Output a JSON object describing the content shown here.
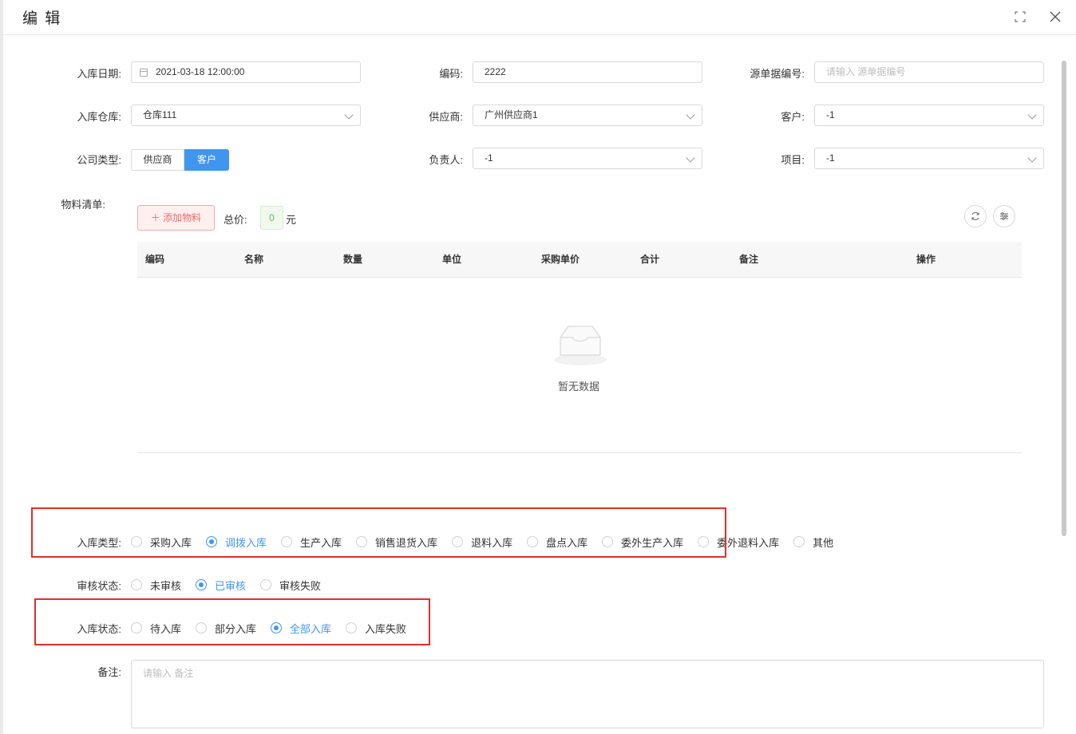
{
  "header": {
    "title": "编 辑"
  },
  "form": {
    "inbound_date": {
      "label": "入库日期:",
      "value": "2021-03-18 12:00:00"
    },
    "code": {
      "label": "编码:",
      "value": "2222"
    },
    "source_no": {
      "label": "源单据编号:",
      "placeholder": "请输入 源单据编号"
    },
    "warehouse": {
      "label": "入库仓库:",
      "value": "仓库111"
    },
    "supplier": {
      "label": "供应商:",
      "value": "广州供应商1"
    },
    "customer": {
      "label": "客户:",
      "value": "-1"
    },
    "company_type": {
      "label": "公司类型:",
      "options": [
        "供应商",
        "客户"
      ],
      "selected": "客户"
    },
    "person": {
      "label": "负责人:",
      "value": "-1"
    },
    "project": {
      "label": "项目:",
      "value": "-1"
    }
  },
  "materials": {
    "label": "物料清单:",
    "add_button": "添加物料",
    "total_label": "总价:",
    "total_value": "0",
    "currency": "元",
    "columns": [
      "编码",
      "名称",
      "数量",
      "单位",
      "采购单价",
      "合计",
      "备注",
      "操作"
    ],
    "empty_text": "暂无数据"
  },
  "inbound_type": {
    "label": "入库类型:",
    "options": [
      "采购入库",
      "调拨入库",
      "生产入库",
      "销售退货入库",
      "退料入库",
      "盘点入库",
      "委外生产入库",
      "委外退料入库",
      "其他"
    ],
    "selected": "调拨入库"
  },
  "audit_status": {
    "label": "审核状态:",
    "options": [
      "未审核",
      "已审核",
      "审核失败"
    ],
    "selected": "已审核"
  },
  "inbound_status": {
    "label": "入库状态:",
    "options": [
      "待入库",
      "部分入库",
      "全部入库",
      "入库失败"
    ],
    "selected": "全部入库"
  },
  "remark": {
    "label": "备注:",
    "placeholder": "请输入 备注"
  },
  "colors": {
    "primary": "#4096ee",
    "danger": "#e0302a",
    "success": "#67b55a"
  }
}
